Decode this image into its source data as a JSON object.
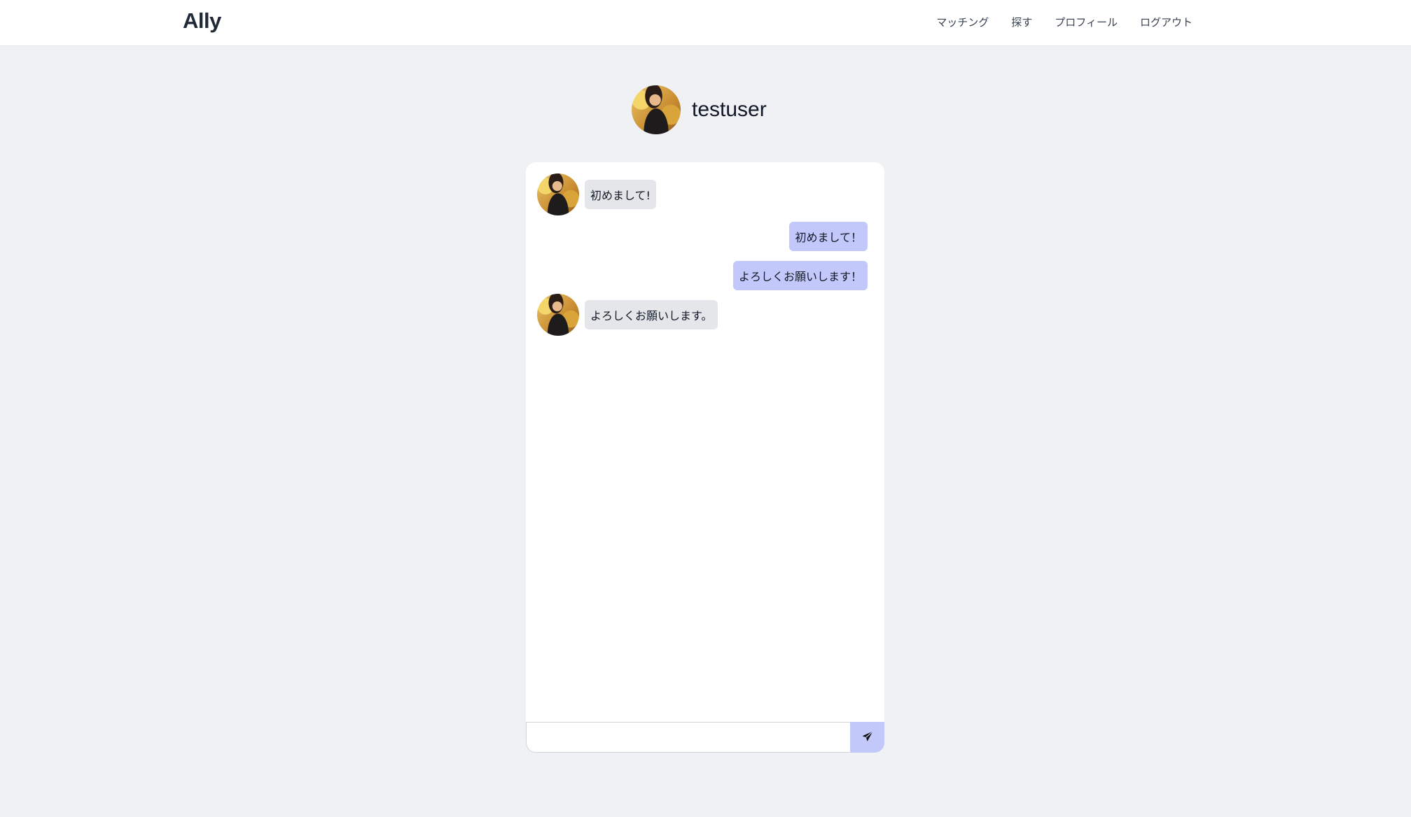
{
  "app": {
    "brand": "Ally"
  },
  "nav": {
    "links": [
      {
        "label": "マッチング"
      },
      {
        "label": "探す"
      },
      {
        "label": "プロフィール"
      },
      {
        "label": "ログアウト"
      }
    ]
  },
  "profile": {
    "name": "testuser"
  },
  "chat": {
    "messages": [
      {
        "direction": "in",
        "text": "初めまして!"
      },
      {
        "direction": "out",
        "text": "初めまして！"
      },
      {
        "direction": "out",
        "text": "よろしくお願いします！"
      },
      {
        "direction": "in",
        "text": "よろしくお願いします。"
      }
    ],
    "input": {
      "value": "",
      "placeholder": ""
    },
    "send_icon": "paper-plane-icon"
  },
  "colors": {
    "background": "#f0f1f5",
    "incoming_bubble": "#e5e6ea",
    "outgoing_bubble": "#c3c8fb",
    "send_button": "#c3c8fb"
  }
}
